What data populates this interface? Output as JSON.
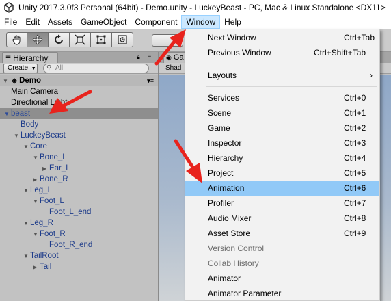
{
  "window": {
    "title": "Unity 2017.3.0f3 Personal (64bit) - Demo.unity - LuckeyBeast - PC, Mac & Linux Standalone <DX11>"
  },
  "menubar": {
    "items": [
      "File",
      "Edit",
      "Assets",
      "GameObject",
      "Component",
      "Window",
      "Help"
    ]
  },
  "toolbar": {
    "tools": [
      "hand-tool",
      "move-tool",
      "rotate-tool",
      "scale-tool",
      "rect-tool",
      "transform-tool"
    ],
    "active_tool": "move-tool"
  },
  "hierarchy": {
    "tab_label": "Hierarchy",
    "create_label": "Create",
    "search_placeholder": "All",
    "scene_name": "Demo",
    "items": [
      {
        "label": "Main Camera",
        "depth": 1,
        "arrow": "",
        "color": "black"
      },
      {
        "label": "Directional Light",
        "depth": 1,
        "arrow": "",
        "color": "black"
      },
      {
        "label": "beast",
        "depth": 1,
        "arrow": "down",
        "color": "blue",
        "selected": true
      },
      {
        "label": "Body",
        "depth": 2,
        "arrow": "",
        "color": "blue"
      },
      {
        "label": "LuckeyBeast",
        "depth": 2,
        "arrow": "down",
        "color": "blue"
      },
      {
        "label": "Core",
        "depth": 3,
        "arrow": "down",
        "color": "blue"
      },
      {
        "label": "Bone_L",
        "depth": 4,
        "arrow": "down",
        "color": "blue"
      },
      {
        "label": "Ear_L",
        "depth": 5,
        "arrow": "right",
        "color": "blue"
      },
      {
        "label": "Bone_R",
        "depth": 4,
        "arrow": "right",
        "color": "blue"
      },
      {
        "label": "Leg_L",
        "depth": 3,
        "arrow": "down",
        "color": "blue"
      },
      {
        "label": "Foot_L",
        "depth": 4,
        "arrow": "down",
        "color": "blue"
      },
      {
        "label": "Foot_L_end",
        "depth": 5,
        "arrow": "",
        "color": "blue"
      },
      {
        "label": "Leg_R",
        "depth": 3,
        "arrow": "down",
        "color": "blue"
      },
      {
        "label": "Foot_R",
        "depth": 4,
        "arrow": "down",
        "color": "blue"
      },
      {
        "label": "Foot_R_end",
        "depth": 5,
        "arrow": "",
        "color": "blue"
      },
      {
        "label": "TailRoot",
        "depth": 3,
        "arrow": "down",
        "color": "blue"
      },
      {
        "label": "Tail",
        "depth": 4,
        "arrow": "right",
        "color": "blue"
      }
    ]
  },
  "scene_panel": {
    "tab_label": "Ga",
    "shading_label": "Shad"
  },
  "window_menu": {
    "items": [
      {
        "label": "Next Window",
        "shortcut": "Ctrl+Tab"
      },
      {
        "label": "Previous Window",
        "shortcut": "Ctrl+Shift+Tab"
      },
      {
        "separator": true
      },
      {
        "label": "Layouts",
        "submenu": true
      },
      {
        "separator": true
      },
      {
        "label": "Services",
        "shortcut": "Ctrl+0"
      },
      {
        "label": "Scene",
        "shortcut": "Ctrl+1"
      },
      {
        "label": "Game",
        "shortcut": "Ctrl+2"
      },
      {
        "label": "Inspector",
        "shortcut": "Ctrl+3"
      },
      {
        "label": "Hierarchy",
        "shortcut": "Ctrl+4"
      },
      {
        "label": "Project",
        "shortcut": "Ctrl+5"
      },
      {
        "label": "Animation",
        "shortcut": "Ctrl+6",
        "highlighted": true
      },
      {
        "label": "Profiler",
        "shortcut": "Ctrl+7"
      },
      {
        "label": "Audio Mixer",
        "shortcut": "Ctrl+8"
      },
      {
        "label": "Asset Store",
        "shortcut": "Ctrl+9"
      },
      {
        "label": "Version Control",
        "disabled": true
      },
      {
        "label": "Collab History",
        "disabled": true
      },
      {
        "label": "Animator"
      },
      {
        "label": "Animator Parameter"
      }
    ]
  },
  "annotations": {
    "arrow_color": "#e8231d"
  }
}
